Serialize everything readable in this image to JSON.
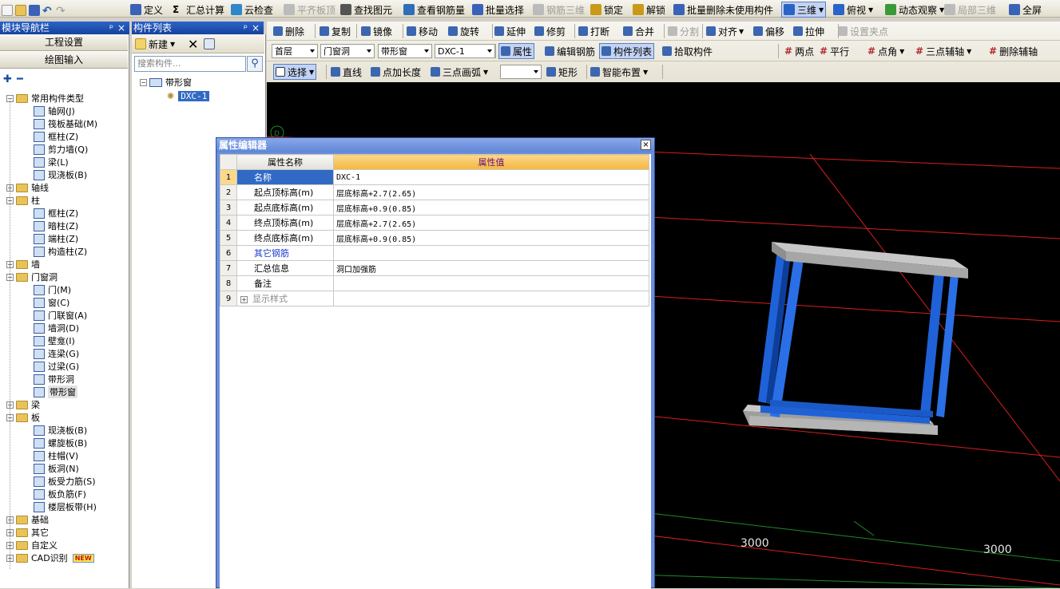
{
  "menubar": {
    "items": [
      {
        "id": "define",
        "label": "定义",
        "icon": "define-icon",
        "enabled": true
      },
      {
        "id": "summary",
        "label": "汇总计算",
        "icon": "sigma-icon",
        "enabled": true
      },
      {
        "id": "cloudcheck",
        "label": "云检查",
        "icon": "cloud-check-icon",
        "enabled": true
      },
      {
        "id": "flatslab",
        "label": "平齐板顶",
        "icon": "flat-slab-icon",
        "enabled": false
      },
      {
        "id": "findelem",
        "label": "查找图元",
        "icon": "binoculars-icon",
        "enabled": true
      },
      {
        "id": "viewrebar",
        "label": "查看钢筋量",
        "icon": "rebar-view-icon",
        "enabled": true
      },
      {
        "id": "batchsel",
        "label": "批量选择",
        "icon": "batch-select-icon",
        "enabled": true
      },
      {
        "id": "rebar3d",
        "label": "钢筋三维",
        "icon": "rebar-3d-icon",
        "enabled": false
      },
      {
        "id": "lock",
        "label": "锁定",
        "icon": "lock-icon",
        "enabled": true
      },
      {
        "id": "unlock",
        "label": "解锁",
        "icon": "unlock-icon",
        "enabled": true
      },
      {
        "id": "batchdel",
        "label": "批量删除未使用构件",
        "icon": "batch-delete-icon",
        "enabled": true
      },
      {
        "id": "view3d",
        "label": "三维",
        "icon": "cube-icon",
        "enabled": true
      },
      {
        "id": "topview",
        "label": "俯视",
        "icon": "top-view-icon",
        "enabled": true
      },
      {
        "id": "dynobs",
        "label": "动态观察",
        "icon": "orbit-icon",
        "enabled": true
      },
      {
        "id": "local3d",
        "label": "局部三维",
        "icon": "local-3d-icon",
        "enabled": false
      },
      {
        "id": "fullscreen",
        "label": "全屏",
        "icon": "zoom-icon",
        "enabled": true
      }
    ]
  },
  "toolbar2": {
    "items": [
      {
        "label": "删除",
        "icon": "delete-icon",
        "enabled": true
      },
      {
        "label": "复制",
        "icon": "copy-icon",
        "enabled": true
      },
      {
        "label": "镜像",
        "icon": "mirror-icon",
        "enabled": true
      },
      {
        "label": "移动",
        "icon": "move-icon",
        "enabled": true
      },
      {
        "label": "旋转",
        "icon": "rotate-icon",
        "enabled": true
      },
      {
        "label": "延伸",
        "icon": "extend-icon",
        "enabled": true
      },
      {
        "label": "修剪",
        "icon": "trim-icon",
        "enabled": true
      },
      {
        "label": "打断",
        "icon": "break-icon",
        "enabled": true
      },
      {
        "label": "合并",
        "icon": "merge-icon",
        "enabled": true
      },
      {
        "label": "分割",
        "icon": "split-icon",
        "enabled": false
      },
      {
        "label": "对齐",
        "icon": "align-icon",
        "enabled": true
      },
      {
        "label": "偏移",
        "icon": "offset-icon",
        "enabled": true
      },
      {
        "label": "拉伸",
        "icon": "stretch-icon",
        "enabled": true
      },
      {
        "label": "设置夹点",
        "icon": "grip-icon",
        "enabled": false
      }
    ]
  },
  "toolbar3": {
    "floor": "首层",
    "category": "门窗洞",
    "type": "带形窗",
    "component": "DXC-1",
    "buttons": [
      {
        "label": "属性",
        "icon": "property-icon",
        "active": true
      },
      {
        "label": "编辑钢筋",
        "icon": "edit-rebar-icon",
        "active": false
      },
      {
        "label": "构件列表",
        "icon": "component-list-icon",
        "active": true
      },
      {
        "label": "拾取构件",
        "icon": "pick-icon",
        "active": false
      }
    ],
    "axis_tools": [
      {
        "label": "两点",
        "icon": "two-point-axis-icon"
      },
      {
        "label": "平行",
        "icon": "parallel-axis-icon"
      },
      {
        "label": "点角",
        "icon": "point-angle-icon"
      },
      {
        "label": "三点辅轴",
        "icon": "three-point-axis-icon"
      },
      {
        "label": "删除辅轴",
        "icon": "delete-axis-icon"
      }
    ]
  },
  "toolbar4": {
    "items": [
      {
        "label": "选择",
        "icon": "cursor-icon",
        "dropdown": true
      },
      {
        "label": "直线",
        "icon": "line-icon",
        "dropdown": false
      },
      {
        "label": "点加长度",
        "icon": "point-length-icon",
        "dropdown": false
      },
      {
        "label": "三点画弧",
        "icon": "arc-icon",
        "dropdown": true
      },
      {
        "label": "矩形",
        "icon": "rectangle-icon",
        "dropdown": false
      },
      {
        "label": "智能布置",
        "icon": "smart-layout-icon",
        "dropdown": true
      }
    ]
  },
  "nav": {
    "title": "模块导航栏",
    "pin": "ᵖ",
    "close": "×",
    "sections": [
      "工程设置",
      "绘图输入"
    ],
    "tree": [
      {
        "label": "常用构件类型",
        "level": 0,
        "folder": true,
        "expanded": true
      },
      {
        "label": "轴网(J)",
        "level": 1
      },
      {
        "label": "筏板基础(M)",
        "level": 1
      },
      {
        "label": "框柱(Z)",
        "level": 1
      },
      {
        "label": "剪力墙(Q)",
        "level": 1
      },
      {
        "label": "梁(L)",
        "level": 1
      },
      {
        "label": "现浇板(B)",
        "level": 1
      },
      {
        "label": "轴线",
        "level": 0,
        "folder": true,
        "expanded": false
      },
      {
        "label": "柱",
        "level": 0,
        "folder": true,
        "expanded": true
      },
      {
        "label": "框柱(Z)",
        "level": 1
      },
      {
        "label": "暗柱(Z)",
        "level": 1
      },
      {
        "label": "端柱(Z)",
        "level": 1
      },
      {
        "label": "构造柱(Z)",
        "level": 1
      },
      {
        "label": "墙",
        "level": 0,
        "folder": true,
        "expanded": false
      },
      {
        "label": "门窗洞",
        "level": 0,
        "folder": true,
        "expanded": true
      },
      {
        "label": "门(M)",
        "level": 1
      },
      {
        "label": "窗(C)",
        "level": 1
      },
      {
        "label": "门联窗(A)",
        "level": 1
      },
      {
        "label": "墙洞(D)",
        "level": 1
      },
      {
        "label": "壁龛(I)",
        "level": 1
      },
      {
        "label": "连梁(G)",
        "level": 1
      },
      {
        "label": "过梁(G)",
        "level": 1
      },
      {
        "label": "带形洞",
        "level": 1
      },
      {
        "label": "带形窗",
        "level": 1,
        "selected": true
      },
      {
        "label": "梁",
        "level": 0,
        "folder": true,
        "expanded": false
      },
      {
        "label": "板",
        "level": 0,
        "folder": true,
        "expanded": true
      },
      {
        "label": "现浇板(B)",
        "level": 1
      },
      {
        "label": "螺旋板(B)",
        "level": 1
      },
      {
        "label": "柱帽(V)",
        "level": 1
      },
      {
        "label": "板洞(N)",
        "level": 1
      },
      {
        "label": "板受力筋(S)",
        "level": 1
      },
      {
        "label": "板负筋(F)",
        "level": 1
      },
      {
        "label": "楼层板带(H)",
        "level": 1
      },
      {
        "label": "基础",
        "level": 0,
        "folder": true,
        "expanded": false
      },
      {
        "label": "其它",
        "level": 0,
        "folder": true,
        "expanded": false
      },
      {
        "label": "自定义",
        "level": 0,
        "folder": true,
        "expanded": false
      },
      {
        "label": "CAD识别",
        "level": 0,
        "folder": true,
        "expanded": false,
        "badge": "NEW"
      }
    ]
  },
  "complist": {
    "title": "构件列表",
    "pin": "ᵖ",
    "close": "×",
    "new_label": "新建",
    "search_placeholder": "搜索构件...",
    "group": "带形窗",
    "item": "DXC-1"
  },
  "propeditor": {
    "title": "属性编辑器",
    "col_name": "属性名称",
    "col_value": "属性值",
    "rows": [
      {
        "n": "1",
        "name": "名称",
        "value": "DXC-1",
        "selected": true
      },
      {
        "n": "2",
        "name": "起点顶标高(m)",
        "value": "层底标高+2.7(2.65)"
      },
      {
        "n": "3",
        "name": "起点底标高(m)",
        "value": "层底标高+0.9(0.85)"
      },
      {
        "n": "4",
        "name": "终点顶标高(m)",
        "value": "层底标高+2.7(2.65)"
      },
      {
        "n": "5",
        "name": "终点底标高(m)",
        "value": "层底标高+0.9(0.85)"
      },
      {
        "n": "6",
        "name": "其它钢筋",
        "value": "",
        "link": true
      },
      {
        "n": "7",
        "name": "汇总信息",
        "value": "洞口加强筋"
      },
      {
        "n": "8",
        "name": "备注",
        "value": ""
      },
      {
        "n": "9",
        "name": "显示样式",
        "value": "",
        "collapsed": true
      }
    ]
  },
  "viewport": {
    "dims": [
      "3000",
      "3000"
    ],
    "axis_marker": "D"
  }
}
